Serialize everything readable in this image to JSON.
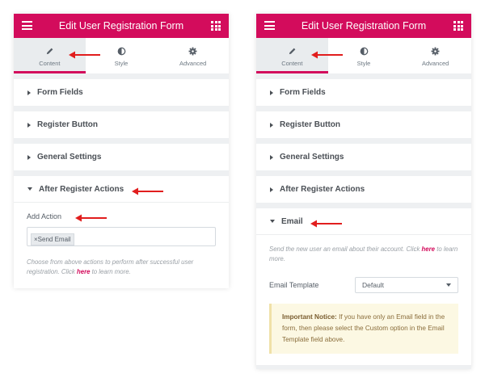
{
  "colors": {
    "brand": "#d30c5c",
    "arrow": "#e11d1d",
    "notice_bg": "#fcf8e3"
  },
  "left": {
    "header": {
      "title": "Edit User Registration Form",
      "menu_icon": "hamburger-icon",
      "apps_icon": "grid-icon"
    },
    "tabs": [
      {
        "label": "Content",
        "icon": "pencil-icon",
        "active": true
      },
      {
        "label": "Style",
        "icon": "half-circle-icon",
        "active": false
      },
      {
        "label": "Advanced",
        "icon": "gear-icon",
        "active": false
      }
    ],
    "sections": [
      {
        "label": "Form Fields"
      },
      {
        "label": "Register Button"
      },
      {
        "label": "General Settings"
      }
    ],
    "open_section": {
      "label": "After Register Actions",
      "add_action_label": "Add Action",
      "tag": "Send Email",
      "tag_remove": "×",
      "help_before": "Choose from above actions to perform after successful user registration. Click",
      "help_link": "here",
      "help_after": "to learn more."
    }
  },
  "right": {
    "header": {
      "title": "Edit User Registration Form",
      "menu_icon": "hamburger-icon",
      "apps_icon": "grid-icon"
    },
    "tabs": [
      {
        "label": "Content",
        "icon": "pencil-icon",
        "active": true
      },
      {
        "label": "Style",
        "icon": "half-circle-icon",
        "active": false
      },
      {
        "label": "Advanced",
        "icon": "gear-icon",
        "active": false
      }
    ],
    "sections": [
      {
        "label": "Form Fields"
      },
      {
        "label": "Register Button"
      },
      {
        "label": "General Settings"
      },
      {
        "label": "After Register Actions"
      }
    ],
    "open_section": {
      "label": "Email",
      "help_before": "Send the new user an email about their account. Click",
      "help_link": "here",
      "help_after": "to learn more.",
      "template_label": "Email Template",
      "template_value": "Default",
      "notice_strong": "Important Notice:",
      "notice_text": "If you have only an Email field in the form, then please select the Custom option in the Email Template field above."
    }
  }
}
